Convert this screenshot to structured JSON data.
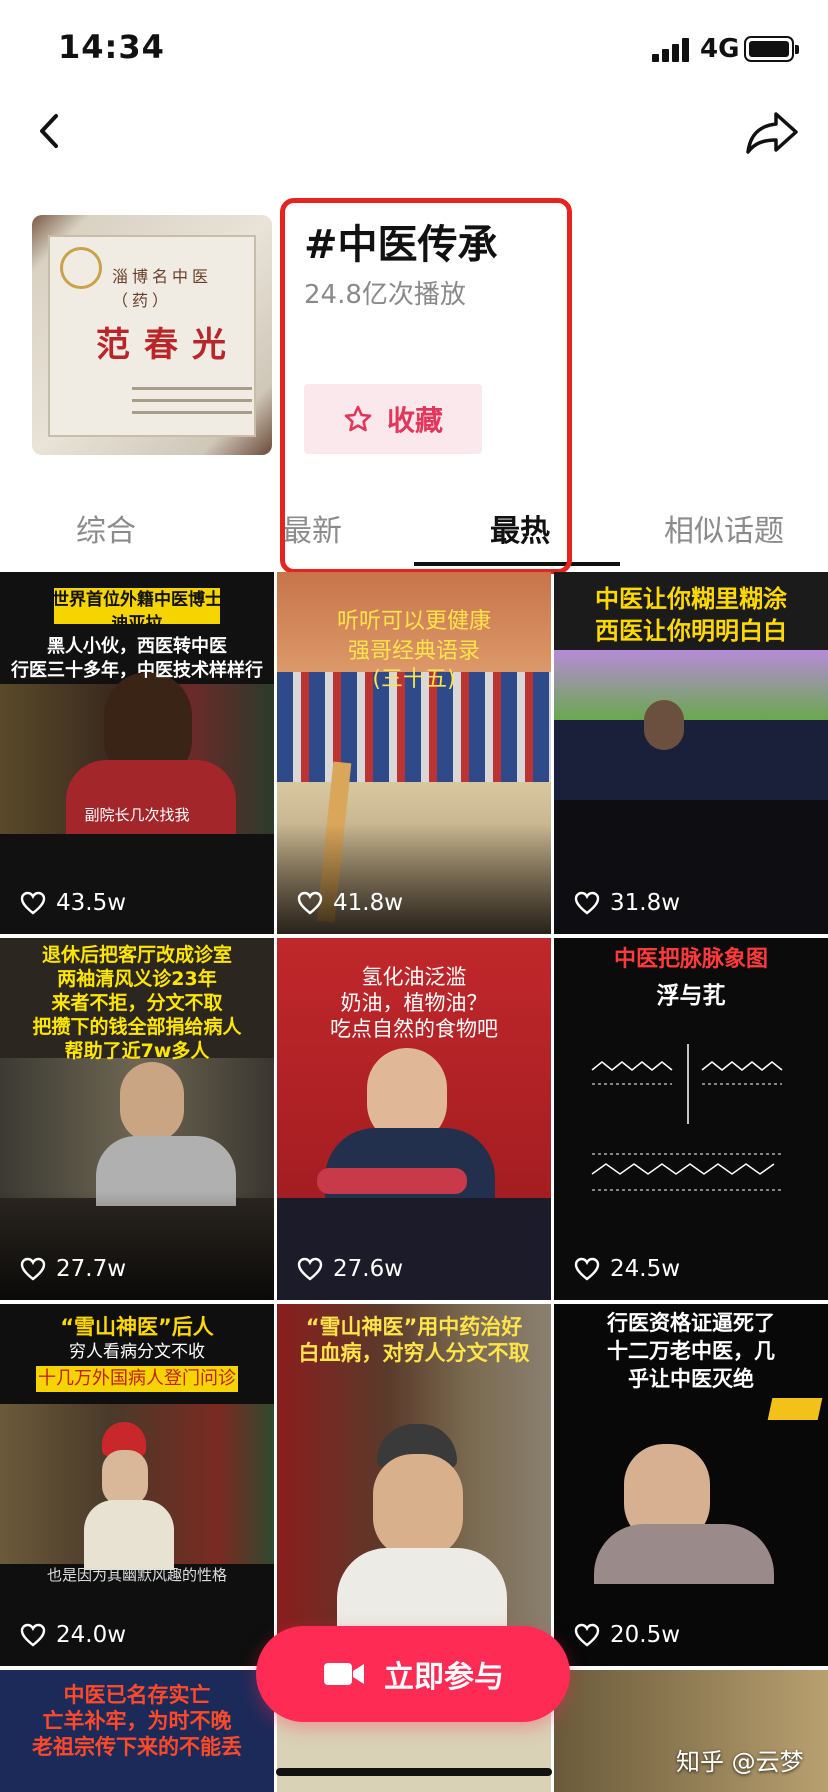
{
  "status": {
    "time": "14:34",
    "network": "4G"
  },
  "topic": {
    "title": "#中医传承",
    "plays": "24.8亿次播放",
    "fav_label": "收藏",
    "cover": {
      "org": "淄博名中医（药）",
      "name": "范春光"
    }
  },
  "tabs": [
    "综合",
    "最新",
    "最热",
    "相似话题"
  ],
  "active_tab": "最热",
  "videos": [
    {
      "likes": "43.5w",
      "caption": [
        "世界首位外籍中医博士",
        "迪亚拉",
        "黑人小伙，西医转中医",
        "行医三十多年，中医技术样样行"
      ],
      "subtitle": "副院长几次找我"
    },
    {
      "likes": "41.8w",
      "caption": [
        "听听可以更健康",
        "强哥经典语录",
        "(三十五)"
      ]
    },
    {
      "likes": "31.8w",
      "caption": [
        "中医让你糊里糊涂",
        "西医让你明明白白"
      ]
    },
    {
      "likes": "27.7w",
      "caption": [
        "退休后把客厅改成诊室",
        "两袖清风义诊23年",
        "来者不拒，分文不取",
        "把攒下的钱全部捐给病人",
        "帮助了近7w多人"
      ]
    },
    {
      "likes": "27.6w",
      "caption": [
        "氢化油泛滥",
        "奶油，植物油？",
        "吃点自然的食物吧"
      ]
    },
    {
      "likes": "24.5w",
      "caption": [
        "中医把脉脉象图",
        "浮与芤"
      ]
    },
    {
      "likes": "24.0w",
      "caption": [
        "“雪山神医”后人",
        "穷人看病分文不收",
        "十几万外国病人登门问诊"
      ],
      "subtitle": "也是因为其幽默风趣的性格"
    },
    {
      "likes": "",
      "caption": [
        "“雪山神医”用中药治好",
        "白血病，对穷人分文不取"
      ]
    },
    {
      "likes": "20.5w",
      "caption": [
        "行医资格证逼死了",
        "十二万老中医，几",
        "乎让中医灭绝"
      ]
    },
    {
      "likes": "",
      "caption": [
        "中医已名存实亡",
        "亡羊补牢，为时不晚",
        "老祖宗传下来的不能丢"
      ]
    }
  ],
  "join_label": "立即参与",
  "watermark": "知乎 @云梦"
}
